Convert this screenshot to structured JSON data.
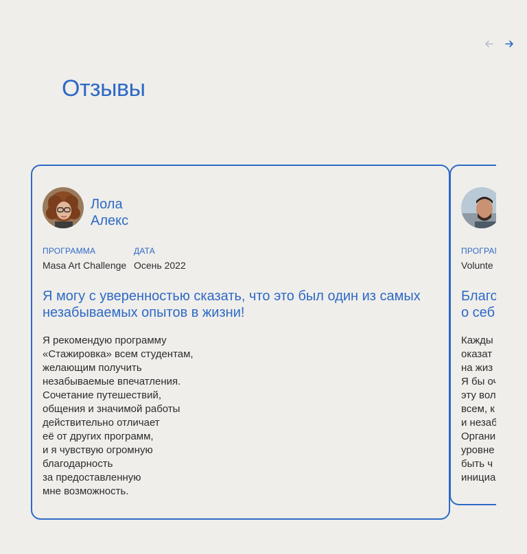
{
  "nav": {
    "prev_icon": "arrow-left-icon",
    "next_icon": "arrow-right-icon",
    "prev_color": "#b8bec8",
    "next_color": "#2e69c5"
  },
  "section": {
    "title": "Отзывы"
  },
  "colors": {
    "accent": "#2e69c5",
    "background": "#efeeeb",
    "text": "#2c2c2c"
  },
  "testimonials": [
    {
      "name": "Лола\nАлекс",
      "program_label": "ПРОГРАММА",
      "program": "Masa Art Challenge",
      "date_label": "ДАТА",
      "date": "Осень 2022",
      "quote": "Я могу с уверенностью сказать, что это был один из самых незабываемых опытов в жизни!",
      "text": "Я рекомендую программу\n«Стажировка» всем студентам,\nжелающим получить\nнезабываемые впечатления.\nСочетание путешествий,\nобщения и значимой работы\nдействительно отличает\nеё от других программ,\nи я чувствую огромную\nблагодарность\nза предоставленную\nмне возможность."
    },
    {
      "program_label": "ПРОГРАМ",
      "program": "Volunte",
      "quote": "Благо\nо себ",
      "text": "Кажды\nоказат\nна жиз\nЯ бы оч\nэту вол\nвсем, к\nи незаб\nОргани\nуровне\nбыть ч\nинициа"
    }
  ]
}
